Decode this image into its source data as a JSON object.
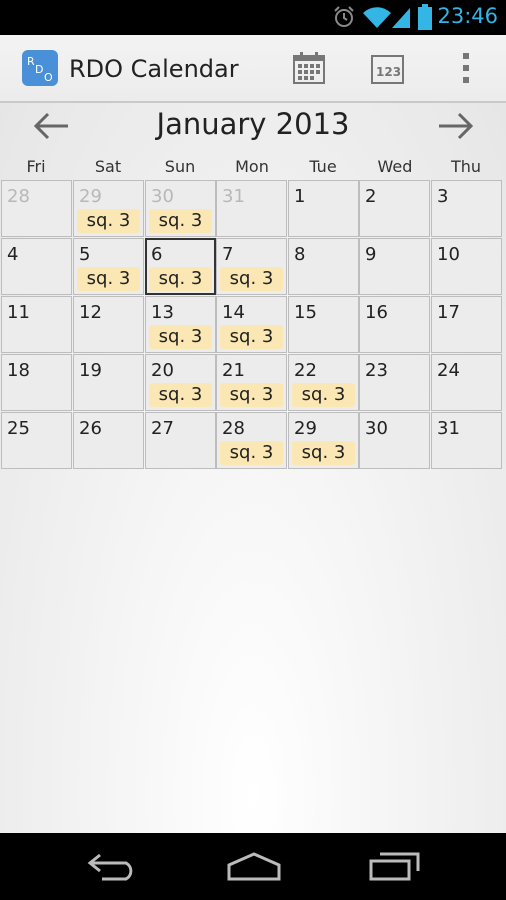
{
  "status_bar": {
    "time": "23:46",
    "icons": [
      "alarm-icon",
      "wifi-icon",
      "signal-icon",
      "battery-icon"
    ]
  },
  "action_bar": {
    "title": "RDO Calendar",
    "app_icon_letters": "RDO",
    "actions": [
      "calendar-view-icon",
      "day-numbers-icon",
      "overflow-menu-icon"
    ],
    "accent": "#4a90d9"
  },
  "calendar": {
    "month_title": "January 2013",
    "weekdays": [
      "Fri",
      "Sat",
      "Sun",
      "Mon",
      "Tue",
      "Wed",
      "Thu"
    ],
    "badge_color": "#fbe7b4",
    "weeks": [
      [
        {
          "day": "28",
          "other": true,
          "badge": ""
        },
        {
          "day": "29",
          "other": true,
          "badge": "sq. 3"
        },
        {
          "day": "30",
          "other": true,
          "badge": "sq. 3"
        },
        {
          "day": "31",
          "other": true,
          "badge": ""
        },
        {
          "day": "1",
          "other": false,
          "badge": ""
        },
        {
          "day": "2",
          "other": false,
          "badge": ""
        },
        {
          "day": "3",
          "other": false,
          "badge": ""
        }
      ],
      [
        {
          "day": "4",
          "other": false,
          "badge": ""
        },
        {
          "day": "5",
          "other": false,
          "badge": "sq. 3"
        },
        {
          "day": "6",
          "other": false,
          "badge": "sq. 3",
          "selected": true
        },
        {
          "day": "7",
          "other": false,
          "badge": "sq. 3"
        },
        {
          "day": "8",
          "other": false,
          "badge": ""
        },
        {
          "day": "9",
          "other": false,
          "badge": ""
        },
        {
          "day": "10",
          "other": false,
          "badge": ""
        }
      ],
      [
        {
          "day": "11",
          "other": false,
          "badge": ""
        },
        {
          "day": "12",
          "other": false,
          "badge": ""
        },
        {
          "day": "13",
          "other": false,
          "badge": "sq. 3"
        },
        {
          "day": "14",
          "other": false,
          "badge": "sq. 3"
        },
        {
          "day": "15",
          "other": false,
          "badge": ""
        },
        {
          "day": "16",
          "other": false,
          "badge": ""
        },
        {
          "day": "17",
          "other": false,
          "badge": ""
        }
      ],
      [
        {
          "day": "18",
          "other": false,
          "badge": ""
        },
        {
          "day": "19",
          "other": false,
          "badge": ""
        },
        {
          "day": "20",
          "other": false,
          "badge": "sq. 3"
        },
        {
          "day": "21",
          "other": false,
          "badge": "sq. 3"
        },
        {
          "day": "22",
          "other": false,
          "badge": "sq. 3"
        },
        {
          "day": "23",
          "other": false,
          "badge": ""
        },
        {
          "day": "24",
          "other": false,
          "badge": ""
        }
      ],
      [
        {
          "day": "25",
          "other": false,
          "badge": ""
        },
        {
          "day": "26",
          "other": false,
          "badge": ""
        },
        {
          "day": "27",
          "other": false,
          "badge": ""
        },
        {
          "day": "28",
          "other": false,
          "badge": "sq. 3"
        },
        {
          "day": "29",
          "other": false,
          "badge": "sq. 3"
        },
        {
          "day": "30",
          "other": false,
          "badge": ""
        },
        {
          "day": "31",
          "other": false,
          "badge": ""
        }
      ]
    ]
  },
  "nav_bar": {
    "buttons": [
      "back-icon",
      "home-icon",
      "recent-apps-icon"
    ]
  }
}
